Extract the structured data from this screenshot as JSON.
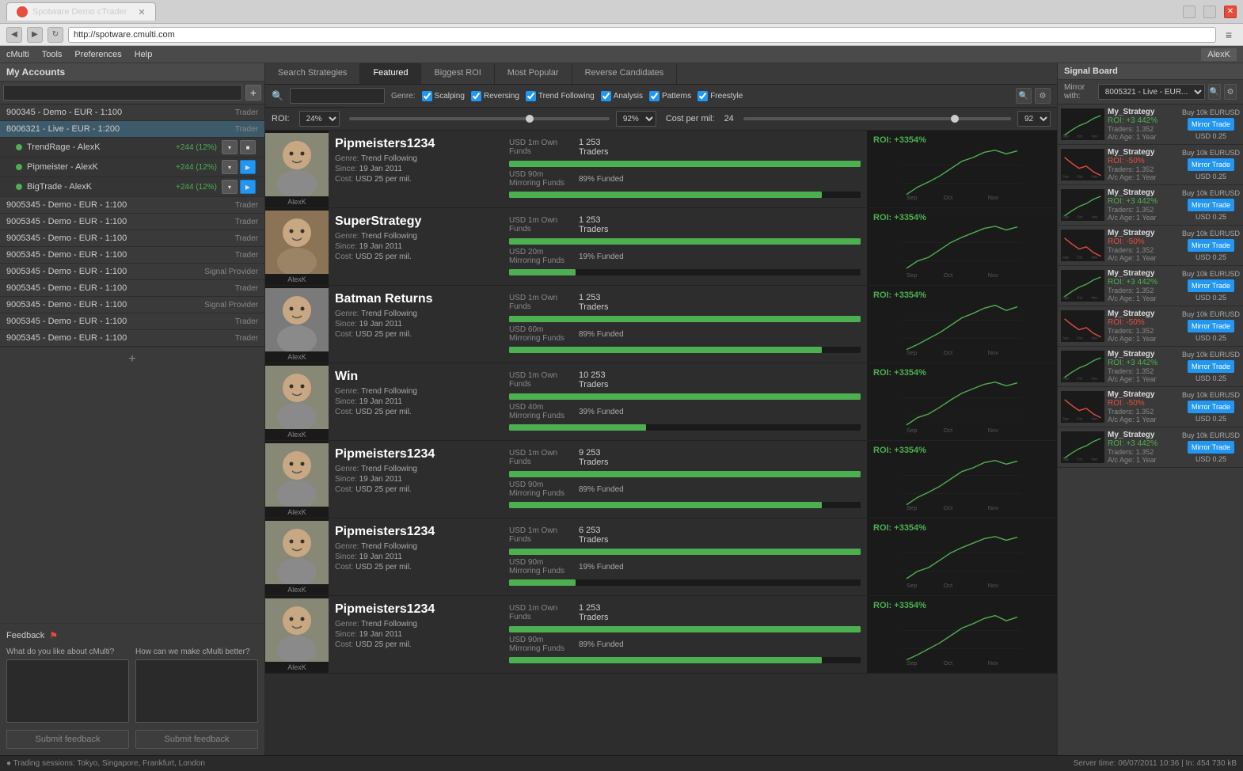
{
  "browser": {
    "tab_title": "Spotware Demo cTrader",
    "url": "http://spotware.cmulti.com",
    "user": "AlexK"
  },
  "menubar": {
    "items": [
      "cMulti",
      "Tools",
      "Preferences",
      "Help"
    ]
  },
  "left_panel": {
    "title": "My Accounts",
    "search_placeholder": "",
    "add_label": "+",
    "accounts": [
      {
        "name": "900345 - Demo - EUR - 1:100",
        "role": "Trader"
      },
      {
        "name": "8006321 - Live - EUR - 1:200",
        "role": "Trader"
      }
    ],
    "sub_accounts": [
      {
        "name": "TrendRage - AlexK",
        "gain": "+244 (12%)",
        "has_play": false,
        "has_stop": true
      },
      {
        "name": "Pipmeister - AlexK",
        "gain": "+244 (12%)",
        "has_play": true,
        "has_stop": false
      },
      {
        "name": "BigTrade - AlexK",
        "gain": "+244 (12%)",
        "has_play": true,
        "has_stop": false
      }
    ],
    "more_accounts": [
      {
        "name": "9005345 - Demo - EUR - 1:100",
        "role": "Trader"
      },
      {
        "name": "9005345 - Demo - EUR - 1:100",
        "role": "Trader"
      },
      {
        "name": "9005345 - Demo - EUR - 1:100",
        "role": "Trader"
      },
      {
        "name": "9005345 - Demo - EUR - 1:100",
        "role": "Trader"
      },
      {
        "name": "9005345 - Demo - EUR - 1:100",
        "role": "Signal Provider"
      },
      {
        "name": "9005345 - Demo - EUR - 1:100",
        "role": "Trader"
      },
      {
        "name": "9005345 - Demo - EUR - 1:100",
        "role": "Signal Provider"
      },
      {
        "name": "9005345 - Demo - EUR - 1:100",
        "role": "Trader"
      },
      {
        "name": "9005345 - Demo - EUR - 1:100",
        "role": "Trader"
      }
    ],
    "add_account_label": "+"
  },
  "feedback": {
    "title": "Feedback",
    "question1": "What do you like about cMulti?",
    "question2": "How can we make cMulti better?",
    "submit_label": "Submit feedback"
  },
  "status_bar": {
    "text": "● Trading sessions: Tokyo, Singapore, Frankfurt, London"
  },
  "center": {
    "tabs": [
      {
        "label": "Search Strategies",
        "active": false
      },
      {
        "label": "Featured",
        "active": true
      },
      {
        "label": "Biggest ROI",
        "active": false
      },
      {
        "label": "Most Popular",
        "active": false
      },
      {
        "label": "Reverse Candidates",
        "active": false
      }
    ],
    "filters": {
      "genre_label": "Genre:",
      "options": [
        "Scalping",
        "Reversing",
        "Trend Following",
        "Analysis",
        "Patterns",
        "Freestyle"
      ]
    },
    "roi_label": "ROI:",
    "roi_value": "24%",
    "roi_slider_val": "92%",
    "cost_label": "Cost per mil:",
    "cost_value": "24",
    "cost_slider_val": "92",
    "strategies": [
      {
        "name": "Pipmeisters1234",
        "genre": "Trend Following",
        "since": "19 Jan 2011",
        "cost": "USD 25 per mil.",
        "own_funds": "USD 1m",
        "own_traders": "1 253 Traders",
        "mirroring_funds": "USD 90m",
        "mirroring_pct": "89% Funded",
        "mirroring_bar": 89,
        "roi": "+3354%",
        "avatar_name": "AlexK",
        "chart_color": "green"
      },
      {
        "name": "SuperStrategy",
        "genre": "Trend Following",
        "since": "19 Jan 2011",
        "cost": "USD 25 per mil.",
        "own_funds": "USD 1m",
        "own_traders": "1 253 Traders",
        "mirroring_funds": "USD 20m",
        "mirroring_pct": "19% Funded",
        "mirroring_bar": 19,
        "roi": "+3354%",
        "avatar_name": "AlexK",
        "chart_color": "green"
      },
      {
        "name": "Batman Returns",
        "genre": "Trend Following",
        "since": "19 Jan 2011",
        "cost": "USD 25 per mil.",
        "own_funds": "USD 1m",
        "own_traders": "1 253 Traders",
        "mirroring_funds": "USD 60m",
        "mirroring_pct": "89% Funded",
        "mirroring_bar": 89,
        "roi": "+3354%",
        "avatar_name": "AlexK",
        "chart_color": "green"
      },
      {
        "name": "Win",
        "genre": "Trend Following",
        "since": "19 Jan 2011",
        "cost": "USD 25 per mil.",
        "own_funds": "USD 1m",
        "own_traders": "10 253 Traders",
        "mirroring_funds": "USD 40m",
        "mirroring_pct": "39% Funded",
        "mirroring_bar": 39,
        "roi": "+3354%",
        "avatar_name": "AlexK",
        "chart_color": "green"
      },
      {
        "name": "Pipmeisters1234",
        "genre": "Trend Following",
        "since": "19 Jan 2011",
        "cost": "USD 25 per mil.",
        "own_funds": "USD 1m",
        "own_traders": "9 253 Traders",
        "mirroring_funds": "USD 90m",
        "mirroring_pct": "89% Funded",
        "mirroring_bar": 89,
        "roi": "+3354%",
        "avatar_name": "AlexK",
        "chart_color": "green"
      },
      {
        "name": "Pipmeisters1234",
        "genre": "Trend Following",
        "since": "19 Jan 2011",
        "cost": "USD 25 per mil.",
        "own_funds": "USD 1m",
        "own_traders": "6 253 Traders",
        "mirroring_funds": "USD 90m",
        "mirroring_pct": "19% Funded",
        "mirroring_bar": 19,
        "roi": "+3354%",
        "avatar_name": "AlexK",
        "chart_color": "green"
      },
      {
        "name": "Pipmeisters1234",
        "genre": "Trend Following",
        "since": "19 Jan 2011",
        "cost": "USD 25 per mil.",
        "own_funds": "USD 1m",
        "own_traders": "1 253 Traders",
        "mirroring_funds": "USD 90m",
        "mirroring_pct": "89% Funded",
        "mirroring_bar": 89,
        "roi": "+3354%",
        "avatar_name": "AlexK",
        "chart_color": "green"
      }
    ]
  },
  "signal_board": {
    "title": "Signal Board",
    "mirror_with_label": "Mirror with:",
    "mirror_account": "8005321 - Live - EUR...",
    "signals": [
      {
        "name": "My_Strategy",
        "roi": "ROI: +3 442%",
        "roi_type": "green",
        "traders": "Traders: 1.352",
        "age": "A/c Age: 1 Year",
        "price": "USD 0.25",
        "btn": "Mirror Trade",
        "buy": "Buy 10k EURUSD"
      },
      {
        "name": "My_Strategy",
        "roi": "ROI: -50%",
        "roi_type": "red",
        "traders": "Traders: 1.352",
        "age": "A/c Age: 1 Year",
        "price": "USD 0.25",
        "btn": "Mirror Trade",
        "buy": "Buy 10k EURUSD"
      },
      {
        "name": "My_Strategy",
        "roi": "ROI: +3 442%",
        "roi_type": "green",
        "traders": "Traders: 1.352",
        "age": "A/c Age: 1 Year",
        "price": "USD 0.25",
        "btn": "Mirror Trade",
        "buy": "Buy 10k EURUSD"
      },
      {
        "name": "My_Strategy",
        "roi": "ROI: -50%",
        "roi_type": "red",
        "traders": "Traders: 1.352",
        "age": "A/c Age: 1 Year",
        "price": "USD 0.25",
        "btn": "Mirror Trade",
        "buy": "Buy 10k EURUSD"
      },
      {
        "name": "My_Strategy",
        "roi": "ROI: +3 442%",
        "roi_type": "green",
        "traders": "Traders: 1.352",
        "age": "A/c Age: 1 Year",
        "price": "USD 0.25",
        "btn": "Mirror Trade",
        "buy": "Buy 10k EURUSD"
      },
      {
        "name": "My_Strategy",
        "roi": "ROI: -50%",
        "roi_type": "red",
        "traders": "Traders: 1.352",
        "age": "A/c Age: 1 Year",
        "price": "USD 0.25",
        "btn": "Mirror Trade",
        "buy": "Buy 10k EURUSD"
      },
      {
        "name": "My_Strategy",
        "roi": "ROI: +3 442%",
        "roi_type": "green",
        "traders": "Traders: 1.352",
        "age": "A/c Age: 1 Year",
        "price": "USD 0.25",
        "btn": "Mirror Trade",
        "buy": "Buy 10k EURUSD"
      },
      {
        "name": "My_Strategy",
        "roi": "ROI: -50%",
        "roi_type": "red",
        "traders": "Traders: 1.352",
        "age": "A/c Age: 1 Year",
        "price": "USD 0.25",
        "btn": "Mirror Trade",
        "buy": "Buy 10k EURUSD"
      },
      {
        "name": "My_Strategy",
        "roi": "ROI: +3 442%",
        "roi_type": "green",
        "traders": "Traders: 1.352",
        "age": "A/c Age: 1 Year",
        "price": "USD 0.25",
        "btn": "Mirror Trade",
        "buy": "Buy 10k EURUSD"
      }
    ]
  },
  "server_time": "Server time: 06/07/2011 10:36 | In: 454 730 kB"
}
